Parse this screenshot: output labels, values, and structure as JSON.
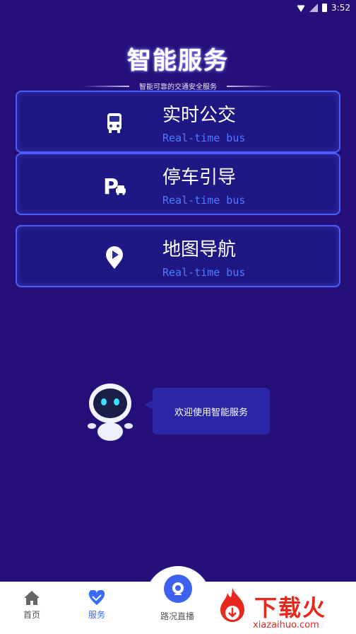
{
  "status_bar": {
    "time": "3:52"
  },
  "header": {
    "title": "智能服务",
    "subtitle": "智能可靠的交通安全服务"
  },
  "services": [
    {
      "title": "实时公交",
      "subtitle": "Real-time bus",
      "icon": "bus-icon"
    },
    {
      "title": "停车引导",
      "subtitle": "Real-time bus",
      "icon": "parking-icon"
    },
    {
      "title": "地图导航",
      "subtitle": "Real-time bus",
      "icon": "map-navigation-icon"
    }
  ],
  "assistant": {
    "message": "欢迎使用智能服务",
    "icon": "robot-icon"
  },
  "tab_bar": {
    "items": [
      {
        "label": "首页",
        "icon": "home-icon"
      },
      {
        "label": "服务",
        "icon": "service-heart-icon",
        "active": true
      },
      {
        "label": "路况直播",
        "icon": "camera-icon"
      }
    ]
  },
  "watermark": {
    "text": "下载火",
    "url": "xiazaihuo.com"
  },
  "colors": {
    "background": "#25107a",
    "card_border": "#4a5dff",
    "accent_blue": "#3a6bff",
    "watermark_red": "#e8281c"
  }
}
